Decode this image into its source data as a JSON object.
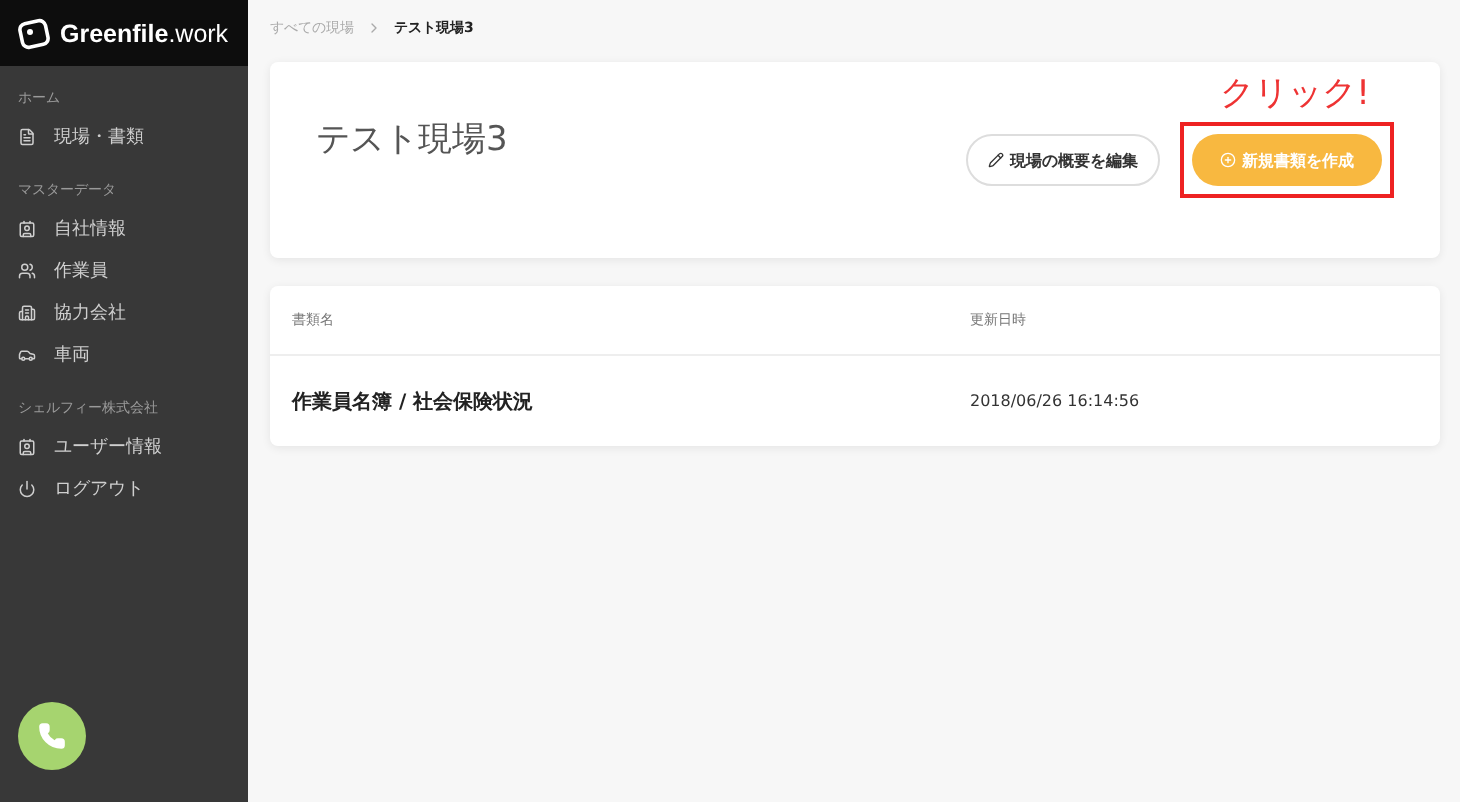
{
  "sidebar": {
    "logo": "**Greenfile**.work",
    "sections": [
      {
        "title": "ホーム",
        "items": [
          {
            "label": "現場・書類",
            "kind": "file"
          }
        ]
      },
      {
        "title": "マスターデータ",
        "items": [
          {
            "label": "自社情報",
            "kind": "contact"
          },
          {
            "label": "作業員",
            "kind": "users"
          },
          {
            "label": "協力会社",
            "kind": "building"
          },
          {
            "label": "車両",
            "kind": "car"
          }
        ]
      },
      {
        "title": "シェルフィー株式会社",
        "items": [
          {
            "label": "ユーザー情報",
            "kind": "contact"
          },
          {
            "label": "ログアウト",
            "kind": "power"
          }
        ]
      }
    ]
  },
  "breadcrumb": [
    "すべての現場",
    "テスト現場3"
  ],
  "header": {
    "title": "テスト現場3",
    "edit_button": "現場の概要を編集",
    "create_button": "新規書類を作成",
    "annotation": "クリック!"
  },
  "table": {
    "columns": [
      "書類名",
      "更新日時"
    ],
    "rows": [
      {
        "name": "作業員名簿 / 社会保険状況",
        "updated": "2018/06/26 16:14:56"
      }
    ]
  }
}
